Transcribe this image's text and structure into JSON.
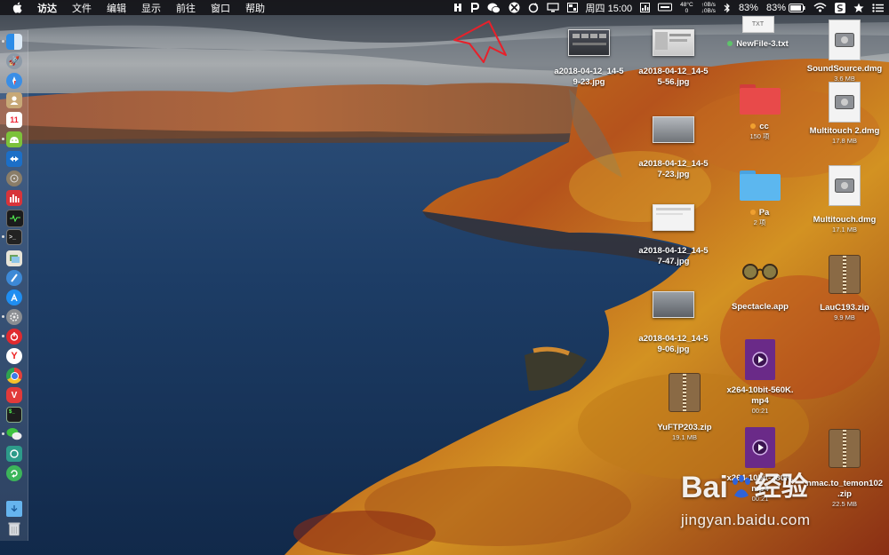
{
  "menubar": {
    "menus": [
      "访达",
      "文件",
      "编辑",
      "显示",
      "前往",
      "窗口",
      "帮助"
    ],
    "clock": "周四 15:00",
    "temp": "48°C",
    "temp_sub": "0",
    "net_up": "0B/s",
    "net_down": "0B/s",
    "battery1": "83%",
    "battery2": "83%"
  },
  "dock": {
    "items": [
      "finder-icon",
      "launchpad-icon",
      "safari-icon",
      "contacts-icon",
      "calendar-icon",
      "android-studio-icon",
      "teamviewer-icon",
      "disk-utility-icon",
      "istat-icon",
      "activity-monitor-icon",
      "terminal-icon",
      "preview-icon",
      "xcode-icon",
      "app-store-icon",
      "system-preferences-icon",
      "netease-music-icon",
      "yandex-icon",
      "chrome-icon",
      "vivaldi-icon",
      "iterm-icon",
      "wechat-icon",
      "sync-icon",
      "reload-icon",
      "downloads-folder-icon",
      "trash-icon"
    ]
  },
  "desktop": {
    "icons": [
      {
        "name": "a2018-04-12_14-5\n9-23.jpg",
        "type": "image"
      },
      {
        "name": "a2018-04-12_14-5\n5-56.jpg",
        "type": "image"
      },
      {
        "name": "NewFile-3.txt",
        "type": "txt",
        "badge": "TXT",
        "tag_color": "#5ec46a"
      },
      {
        "name": "SoundSource.dmg",
        "type": "dmg",
        "size": "3.6 MB"
      },
      {
        "name": "cc",
        "type": "folder",
        "size": "150 项",
        "tag_color": "#f0a030"
      },
      {
        "name": "Multitouch 2.dmg",
        "type": "dmg",
        "size": "17.8 MB"
      },
      {
        "name": "a2018-04-12_14-5\n7-23.jpg",
        "type": "image"
      },
      {
        "name": "Pa",
        "type": "folder",
        "size": "2 项",
        "tag_color": "#f0a030"
      },
      {
        "name": "Multitouch.dmg",
        "type": "dmg",
        "size": "17.1 MB"
      },
      {
        "name": "a2018-04-12_14-5\n7-47.jpg",
        "type": "image"
      },
      {
        "name": "Spectacle.app",
        "type": "app"
      },
      {
        "name": "LauC193.zip",
        "type": "zip",
        "size": "9.9 MB"
      },
      {
        "name": "a2018-04-12_14-5\n9-06.jpg",
        "type": "image"
      },
      {
        "name": "x264-10bit-560K.\nmp4",
        "type": "video",
        "size": "00:21"
      },
      {
        "name": "YuFTP203.zip",
        "type": "zip",
        "size": "19.1 MB"
      },
      {
        "name": "x264-10bit-280K.\nmp4",
        "type": "video",
        "size": "00:21"
      },
      {
        "name": "nmac.to_temon102\n.zip",
        "type": "zip",
        "size": "22.5 MB"
      }
    ]
  },
  "watermark": {
    "brand_left": "Bai",
    "brand_right": "经验",
    "url": "jingyan.baidu.com"
  },
  "colors": {
    "arrow": "#e8202a",
    "folder_red": "#e84a4a",
    "folder_blue": "#5cb7ef"
  }
}
